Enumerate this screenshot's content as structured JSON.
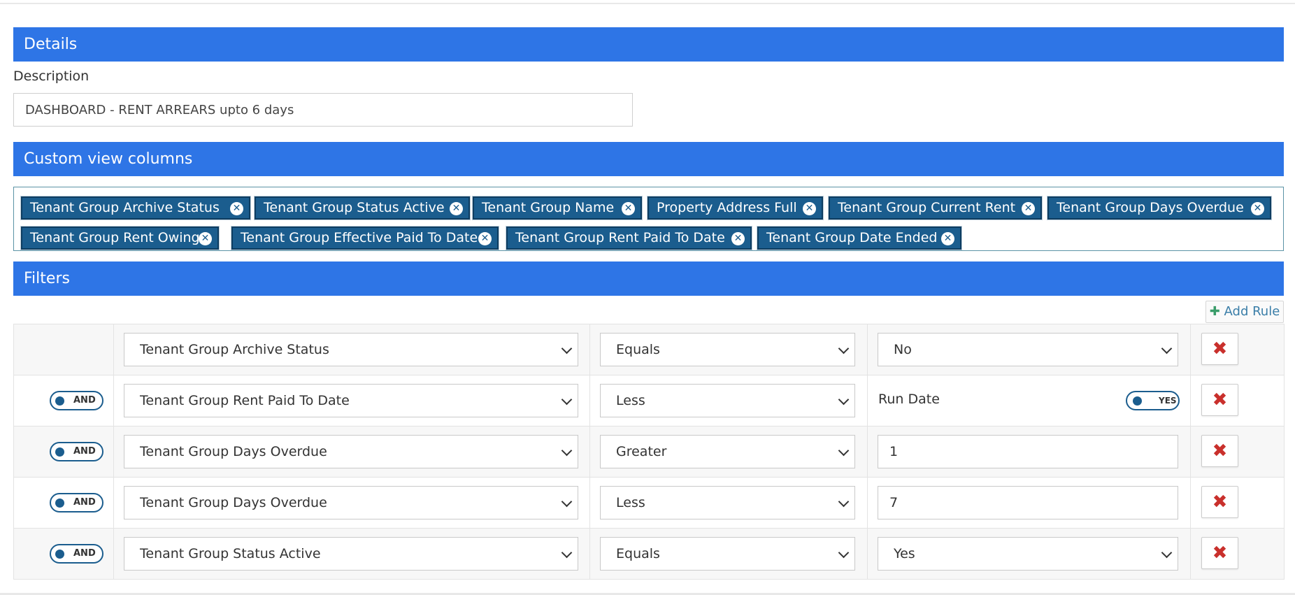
{
  "sections": {
    "details": "Details",
    "columns": "Custom view columns",
    "filters": "Filters"
  },
  "description": {
    "label": "Description",
    "value": "DASHBOARD - RENT ARREARS upto 6 days"
  },
  "columns": [
    "Tenant Group Archive Status",
    "Tenant Group Status Active",
    "Tenant Group Name",
    "Property Address Full",
    "Tenant Group Current Rent",
    "Tenant Group Days Overdue",
    "Tenant Group Rent Owing",
    "Tenant Group Effective Paid To Date",
    "Tenant Group Rent Paid To Date",
    "Tenant Group Date Ended"
  ],
  "add_rule_label": "Add Rule",
  "rules": [
    {
      "condition": "",
      "field": "Tenant Group Archive Status",
      "operator": "Equals",
      "value_type": "select",
      "value": "No"
    },
    {
      "condition": "AND",
      "field": "Tenant Group Rent Paid To Date",
      "operator": "Less",
      "value_type": "rundate",
      "value": "Run Date",
      "toggle": "YES"
    },
    {
      "condition": "AND",
      "field": "Tenant Group Days Overdue",
      "operator": "Greater",
      "value_type": "input",
      "value": "1"
    },
    {
      "condition": "AND",
      "field": "Tenant Group Days Overdue",
      "operator": "Less",
      "value_type": "input",
      "value": "7"
    },
    {
      "condition": "AND",
      "field": "Tenant Group Status Active",
      "operator": "Equals",
      "value_type": "select",
      "value": "Yes"
    }
  ],
  "colors": {
    "header": "#2e75e6",
    "tag": "#1b5d8e",
    "delete": "#c9302c"
  }
}
